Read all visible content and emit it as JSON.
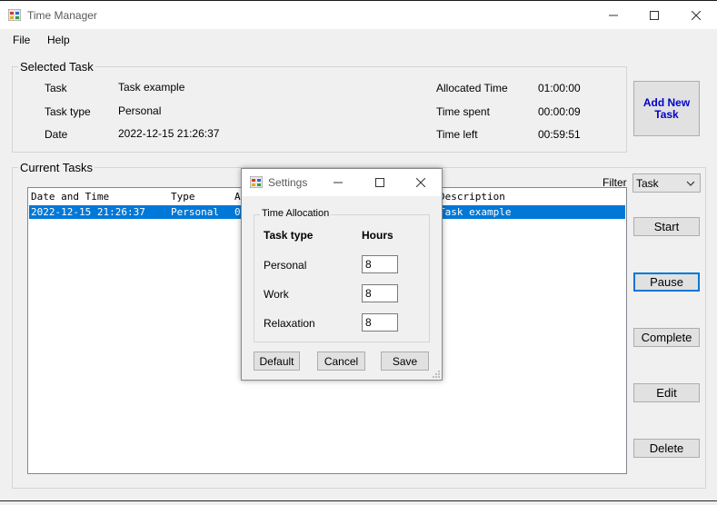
{
  "window": {
    "title": "Time Manager",
    "minimize_glyph": "—",
    "maximize_glyph": "☐",
    "close_glyph": "✕"
  },
  "menu": {
    "file": "File",
    "help": "Help"
  },
  "selected_task": {
    "group_title": "Selected Task",
    "task_label": "Task",
    "task_value": "Task example",
    "type_label": "Task type",
    "type_value": "Personal",
    "date_label": "Date",
    "date_value": "2022-12-15 21:26:37",
    "allocated_label": "Allocated Time",
    "allocated_value": "01:00:00",
    "spent_label": "Time spent",
    "spent_value": "00:00:09",
    "left_label": "Time left",
    "left_value": "00:59:51"
  },
  "add_task_button": {
    "line1": "Add New",
    "line2": "Task"
  },
  "current_tasks": {
    "group_title": "Current Tasks",
    "filter_label": "Filter",
    "filter_value": "Task",
    "columns": {
      "date": "Date and Time",
      "type": "Type",
      "a": "A",
      "description": "Description"
    },
    "rows": [
      {
        "date": "2022-12-15 21:26:37",
        "type": "Personal",
        "a": "0",
        "description": "Task example"
      }
    ]
  },
  "side_buttons": {
    "start": "Start",
    "pause": "Pause",
    "complete": "Complete",
    "edit": "Edit",
    "delete": "Delete"
  },
  "settings_dialog": {
    "title": "Settings",
    "group_title": "Time Allocation",
    "col_task_type": "Task type",
    "col_hours": "Hours",
    "rows": [
      {
        "label": "Personal",
        "value": "8"
      },
      {
        "label": "Work",
        "value": "8"
      },
      {
        "label": "Relaxation",
        "value": "8"
      }
    ],
    "default_button": "Default",
    "cancel_button": "Cancel",
    "save_button": "Save"
  },
  "colors": {
    "accent": "#0078d7",
    "add_task_text": "#0000cc"
  }
}
